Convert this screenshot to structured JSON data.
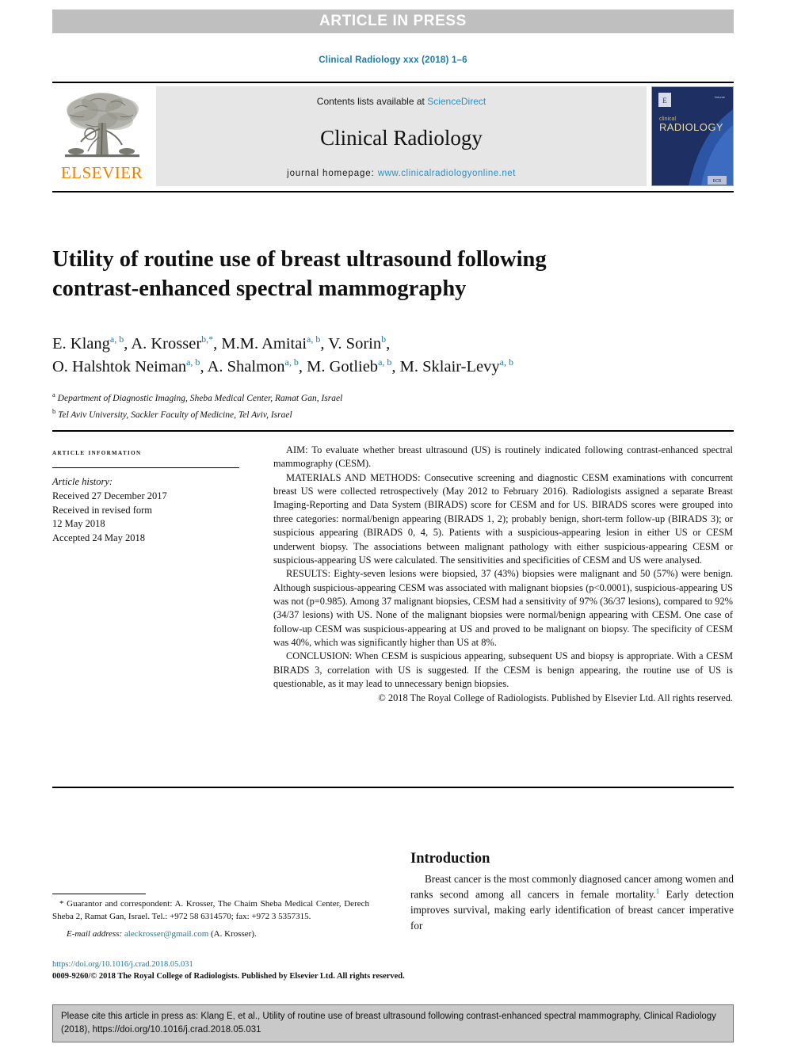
{
  "banner": {
    "text": "ARTICLE IN PRESS"
  },
  "running_head": {
    "text": "Clinical Radiology xxx (2018) 1–6"
  },
  "masthead": {
    "contents_prefix": "Contents lists available at ",
    "sciencedirect": "ScienceDirect",
    "journal_name": "Clinical Radiology",
    "homepage_label": "journal homepage: ",
    "homepage_url": "www.clinicalradiologyonline.net",
    "publisher_wordmark": "ELSEVIER",
    "cover": {
      "title_small": "clinical",
      "title_large": "RADIOLOGY"
    }
  },
  "article": {
    "title": "Utility of routine use of breast ultrasound following contrast-enhanced spectral mammography",
    "authors_line_1": "E. Klang a,b, A. Krosser b,*, M.M. Amitai a,b, V. Sorin b,",
    "authors_line_2": "O. Halshtok Neiman a,b, A. Shalmon a,b, M. Gotlieb a,b, M. Sklair-Levy a,b",
    "authors": [
      {
        "name": "E. Klang",
        "sup": "a, b"
      },
      {
        "name": "A. Krosser",
        "sup": "b,*"
      },
      {
        "name": "M.M. Amitai",
        "sup": "a, b"
      },
      {
        "name": "V. Sorin",
        "sup": "b"
      },
      {
        "name": "O. Halshtok Neiman",
        "sup": "a, b"
      },
      {
        "name": "A. Shalmon",
        "sup": "a, b"
      },
      {
        "name": "M. Gotlieb",
        "sup": "a, b"
      },
      {
        "name": "M. Sklair-Levy",
        "sup": "a, b"
      }
    ],
    "affiliations": [
      {
        "marker": "a",
        "text": "Department of Diagnostic Imaging, Sheba Medical Center, Ramat Gan, Israel"
      },
      {
        "marker": "b",
        "text": "Tel Aviv University, Sackler Faculty of Medicine, Tel Aviv, Israel"
      }
    ]
  },
  "article_info": {
    "heading": "article information",
    "history_label": "Article history:",
    "received": "Received 27 December 2017",
    "revised_label": "Received in revised form",
    "revised_date": "12 May 2018",
    "accepted": "Accepted 24 May 2018"
  },
  "abstract": {
    "aim": "AIM: To evaluate whether breast ultrasound (US) is routinely indicated following contrast-enhanced spectral mammography (CESM).",
    "materials": "MATERIALS AND METHODS: Consecutive screening and diagnostic CESM examinations with concurrent breast US were collected retrospectively (May 2012 to February 2016). Radiologists assigned a separate Breast Imaging-Reporting and Data System (BIRADS) score for CESM and for US. BIRADS scores were grouped into three categories: normal/benign appearing (BIRADS 1, 2); probably benign, short-term follow-up (BIRADS 3); or suspicious appearing (BIRADS 0, 4, 5). Patients with a suspicious-appearing lesion in either US or CESM underwent biopsy. The associations between malignant pathology with either suspicious-appearing CESM or suspicious-appearing US were calculated. The sensitivities and specificities of CESM and US were analysed.",
    "results": "RESULTS: Eighty-seven lesions were biopsied, 37 (43%) biopsies were malignant and 50 (57%) were benign. Although suspicious-appearing CESM was associated with malignant biopsies (p<0.0001), suspicious-appearing US was not (p=0.985). Among 37 malignant biopsies, CESM had a sensitivity of 97% (36/37 lesions), compared to 92% (34/37 lesions) with US. None of the malignant biopsies were normal/benign appearing with CESM. One case of follow-up CESM was suspicious-appearing at US and proved to be malignant on biopsy. The specificity of CESM was 40%, which was significantly higher than US at 8%.",
    "conclusion": "CONCLUSION: When CESM is suspicious appearing, subsequent US and biopsy is appropriate. With a CESM BIRADS 3, correlation with US is suggested. If the CESM is benign appearing, the routine use of US is questionable, as it may lead to unnecessary benign biopsies.",
    "copyright": "© 2018 The Royal College of Radiologists. Published by Elsevier Ltd. All rights reserved."
  },
  "introduction": {
    "heading": "Introduction",
    "paragraph_1": "Breast cancer is the most commonly diagnosed cancer among women and ranks second among all cancers in female mortality.",
    "reference_marker": "1",
    "paragraph_1_cont": " Early detection improves survival, making early identification of breast cancer imperative for"
  },
  "footnotes": {
    "correspondence": "* Guarantor and correspondent: A. Krosser, The Chaim Sheba Medical Center, Derech Sheba 2, Ramat Gan, Israel. Tel.: +972 58 6314570; fax: +972 3 5357315.",
    "email_label": "E-mail address: ",
    "email": "aleckrosser@gmail.com",
    "email_suffix": " (A. Krosser).",
    "doi": "https://doi.org/10.1016/j.crad.2018.05.031",
    "issn_copyright": "0009-9260/© 2018 The Royal College of Radiologists. Published by Elsevier Ltd. All rights reserved."
  },
  "citation_box": {
    "text": "Please cite this article in press as: Klang E, et al., Utility of routine use of breast ultrasound following contrast-enhanced spectral mammography, Clinical Radiology (2018), https://doi.org/10.1016/j.crad.2018.05.031"
  },
  "colors": {
    "link": "#1a7ba8",
    "sciencedirect": "#2f8fc4",
    "elsevier_orange": "#f08000",
    "banner_gray": "#bfbfbf",
    "masthead_gray": "#e6e6e6",
    "cite_box_gray": "#c9c9c9",
    "cover_navy": "#1d2f63"
  }
}
